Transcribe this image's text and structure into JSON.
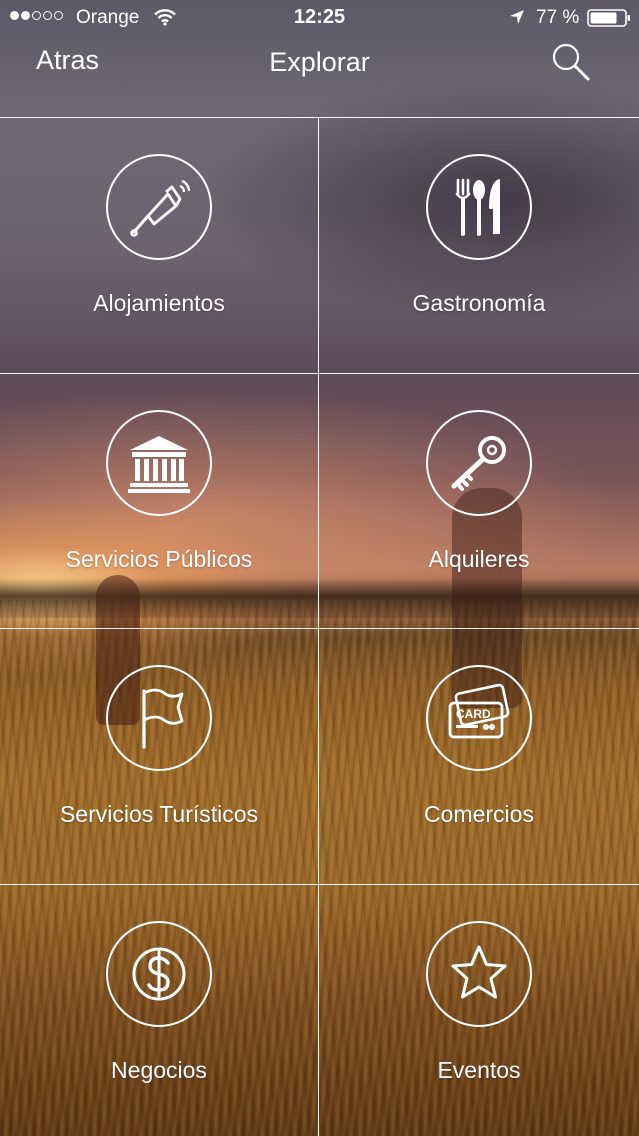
{
  "status_bar": {
    "carrier": "Orange",
    "time": "12:25",
    "battery": "77 %",
    "signal_bars_filled": 2,
    "signal_bars_total": 5
  },
  "nav": {
    "back_label": "Atras",
    "title": "Explorar",
    "search_icon": "search-icon"
  },
  "categories": [
    {
      "label": "Alojamientos",
      "icon": "bell-icon"
    },
    {
      "label": "Gastronomía",
      "icon": "cutlery-icon"
    },
    {
      "label": "Servicios Públicos",
      "icon": "building-icon"
    },
    {
      "label": "Alquileres",
      "icon": "key-icon"
    },
    {
      "label": "Servicios Turísticos",
      "icon": "flag-icon"
    },
    {
      "label": "Comercios",
      "icon": "card-icon",
      "icon_text": "CARD"
    },
    {
      "label": "Negocios",
      "icon": "dollar-icon"
    },
    {
      "label": "Eventos",
      "icon": "star-icon"
    }
  ],
  "colors": {
    "foreground": "#ffffff",
    "grid_lines": "#ffffff"
  }
}
